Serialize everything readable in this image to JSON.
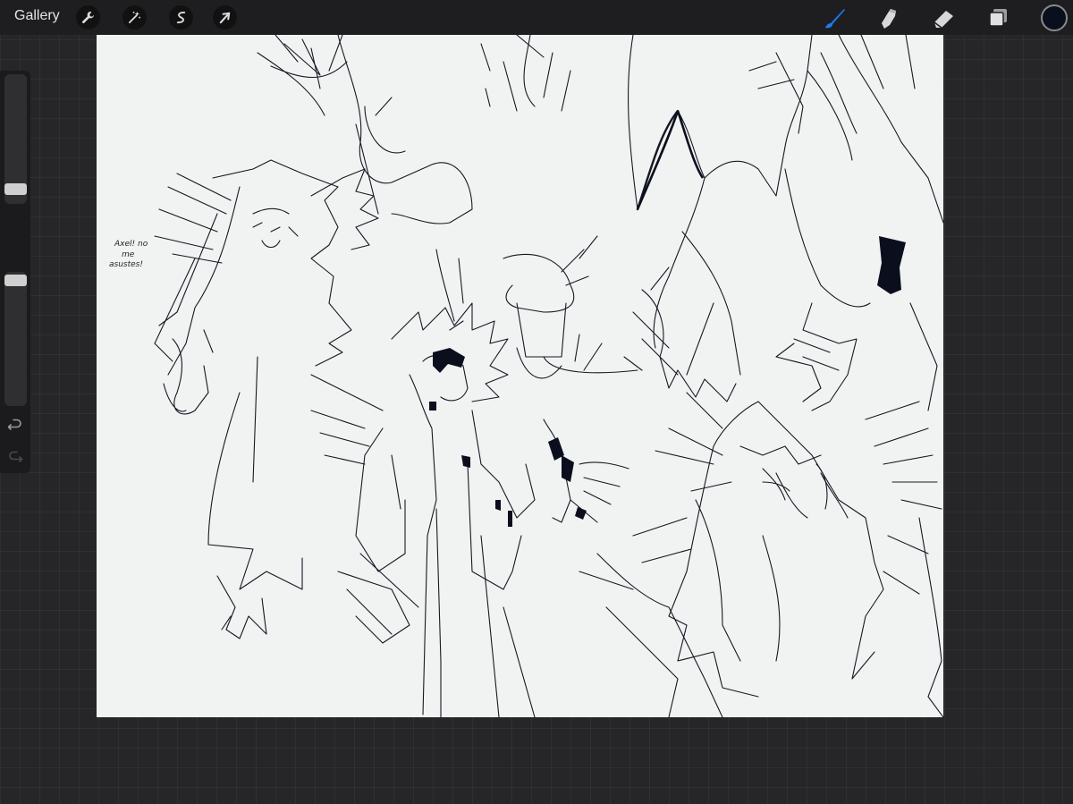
{
  "toolbar": {
    "gallery_label": "Gallery",
    "left_tools": [
      "wrench-icon",
      "magic-wand-icon",
      "selection-icon",
      "transform-arrow-icon"
    ],
    "right_tools": [
      "brush-icon",
      "smudge-icon",
      "eraser-icon",
      "layers-icon"
    ],
    "active_tool": "brush",
    "active_color": "#0a0f1e",
    "accent": "#1a7cf5"
  },
  "sidebar": {
    "size_slider_level": 0.78,
    "opacity_slider_level": 1.0,
    "icons": [
      "modify-square-icon",
      "undo-icon",
      "redo-icon"
    ]
  },
  "canvas": {
    "background": "#f1f3f3",
    "ink": "#151821",
    "annotation_text": [
      "Axel! no",
      "me",
      "asustes!"
    ]
  }
}
